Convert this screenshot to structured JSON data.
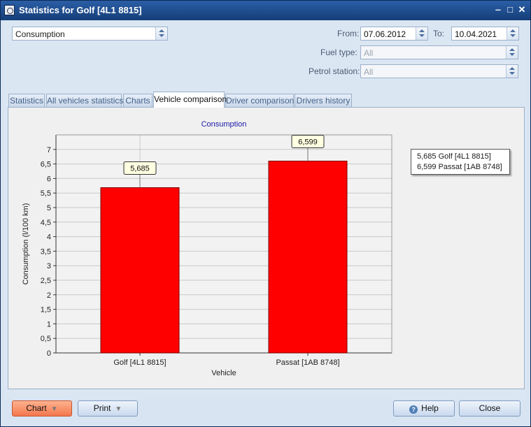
{
  "window": {
    "title": "Statistics for Golf [4L1 8815]"
  },
  "toolbar": {
    "statistic_type": "Consumption",
    "from_label": "From:",
    "from_value": "07.06.2012",
    "to_label": "To:",
    "to_value": "10.04.2021",
    "fuel_label": "Fuel type:",
    "fuel_value": "All",
    "station_label": "Petrol station:",
    "station_value": "All"
  },
  "tabs": [
    {
      "label": "Statistics"
    },
    {
      "label": "All vehicles statistics"
    },
    {
      "label": "Charts"
    },
    {
      "label": "Vehicle comparison"
    },
    {
      "label": "Driver comparison"
    },
    {
      "label": "Drivers history"
    }
  ],
  "active_tab": "Vehicle comparison",
  "chart_data": {
    "type": "bar",
    "title": "Consumption",
    "xlabel": "Vehicle",
    "ylabel": "Consumption (l/100 km)",
    "categories": [
      "Golf [4L1 8815]",
      "Passat [1AB 8748]"
    ],
    "values": [
      5.685,
      6.599
    ],
    "value_labels": [
      "5,685",
      "6,599"
    ],
    "yticks": [
      "0",
      "0,5",
      "1",
      "1,5",
      "2",
      "2,5",
      "3",
      "3,5",
      "4",
      "4,5",
      "5",
      "5,5",
      "6",
      "6,5",
      "7"
    ],
    "ylim": [
      0,
      7.5
    ],
    "grid": true,
    "bar_color": "#ff0000",
    "legend_position": "right",
    "legend": [
      "5,685 Golf [4L1 8815]",
      "6,599 Passat [1AB 8748]"
    ]
  },
  "buttons": {
    "chart": "Chart",
    "print": "Print",
    "help": "Help",
    "close": "Close"
  },
  "colors": {
    "title_bar": "#1f4a80",
    "accent_button": "#f3774e"
  }
}
